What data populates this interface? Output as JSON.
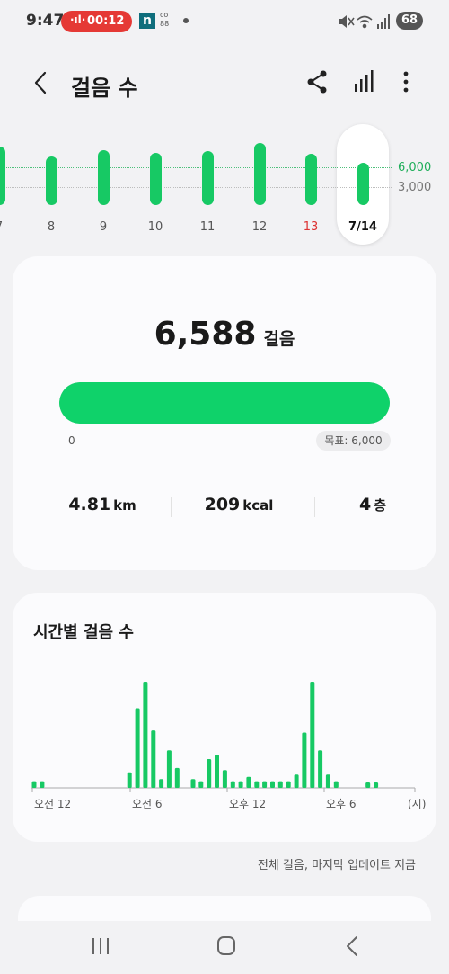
{
  "status_bar": {
    "time": "9:47",
    "recording_time": "00:12",
    "battery": "68",
    "app_icon_n": "n",
    "app_icon_co": "co 88",
    "icons": [
      "mute-icon",
      "wifi-icon",
      "signal-icon"
    ]
  },
  "header": {
    "title": "걸음 수",
    "back_icon": "chevron-left-icon",
    "share_icon": "share-icon",
    "chart_icon": "bar-chart-icon",
    "more_icon": "more-vertical-icon"
  },
  "daily_chart": {
    "guide_labels": [
      "6,000",
      "3,000"
    ],
    "days": [
      {
        "label": "7",
        "steps": 6500
      },
      {
        "label": "8",
        "steps": 5400
      },
      {
        "label": "9",
        "steps": 6100
      },
      {
        "label": "10",
        "steps": 5800
      },
      {
        "label": "11",
        "steps": 6000
      },
      {
        "label": "12",
        "steps": 6900
      },
      {
        "label": "13",
        "steps": 5700,
        "highlight": "sunday"
      },
      {
        "label": "7/14",
        "steps": 6588,
        "selected": true
      }
    ]
  },
  "summary": {
    "steps": "6,588",
    "steps_unit": "걸음",
    "progress_fraction": 1.0,
    "progress_min": "0",
    "goal_label": "목표: 6,000",
    "distance": "4.81",
    "distance_unit": "km",
    "calories": "209",
    "calories_unit": "kcal",
    "floors": "4",
    "floors_unit": "층"
  },
  "hourly": {
    "title": "시간별 걸음 수",
    "axis_labels": [
      "오전 12",
      "오전 6",
      "오후 12",
      "오후 6",
      "(시)"
    ],
    "values": [
      60,
      60,
      0,
      0,
      0,
      0,
      0,
      0,
      0,
      0,
      0,
      0,
      140,
      720,
      960,
      520,
      80,
      340,
      180,
      0,
      80,
      60,
      260,
      300,
      160,
      60,
      60,
      100,
      60,
      60,
      60,
      60,
      60,
      120,
      500,
      960,
      340,
      120,
      60,
      0,
      0,
      0,
      40,
      40,
      0
    ]
  },
  "footer": {
    "update_text": "전체 걸음, 마지막 업데이트 지금"
  },
  "navbar": {
    "recents_icon": "recents-icon",
    "home_icon": "home-icon",
    "back_icon": "back-icon"
  }
}
